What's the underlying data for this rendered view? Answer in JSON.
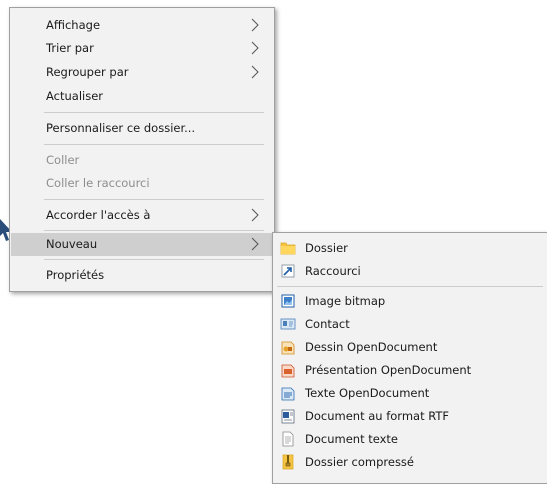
{
  "context_menu": {
    "items": [
      {
        "label": "Affichage"
      },
      {
        "label": "Trier par"
      },
      {
        "label": "Regrouper par"
      },
      {
        "label": "Actualiser"
      },
      {
        "label": "Personnaliser ce dossier..."
      },
      {
        "label": "Coller"
      },
      {
        "label": "Coller le raccourci"
      },
      {
        "label": "Accorder l'accès à"
      },
      {
        "label": "Nouveau"
      },
      {
        "label": "Propriétés"
      }
    ]
  },
  "new_submenu": {
    "items": [
      {
        "label": "Dossier",
        "icon": "folder-icon"
      },
      {
        "label": "Raccourci",
        "icon": "shortcut-icon"
      },
      {
        "label": "Image bitmap",
        "icon": "bitmap-image-icon"
      },
      {
        "label": "Contact",
        "icon": "contact-icon"
      },
      {
        "label": "Dessin OpenDocument",
        "icon": "opendocument-drawing-icon"
      },
      {
        "label": "Présentation OpenDocument",
        "icon": "opendocument-presentation-icon"
      },
      {
        "label": "Texte OpenDocument",
        "icon": "opendocument-text-icon"
      },
      {
        "label": "Document au format RTF",
        "icon": "rtf-document-icon"
      },
      {
        "label": "Document texte",
        "icon": "text-document-icon"
      },
      {
        "label": "Dossier compressé",
        "icon": "compressed-folder-icon"
      }
    ]
  },
  "colors": {
    "menu_background": "#f2f2f2",
    "highlight": "#cfcfcf",
    "disabled_text": "#8d8d8d"
  }
}
